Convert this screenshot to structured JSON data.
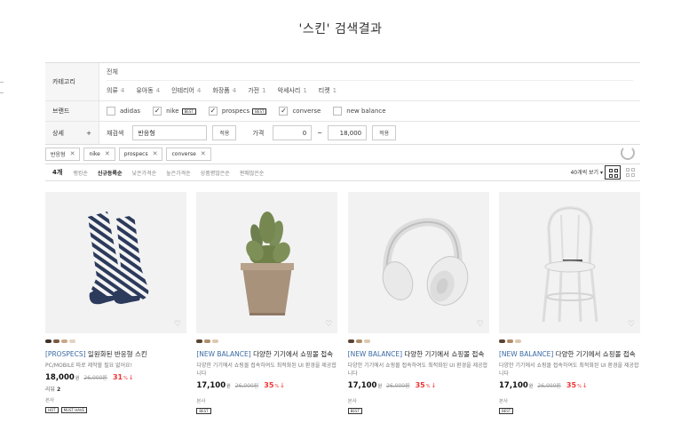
{
  "page": {
    "title": "'스킨' 검색결과"
  },
  "filter": {
    "category": {
      "label": "카테고리",
      "all": "전체",
      "items": [
        {
          "label": "의류",
          "count": "4"
        },
        {
          "label": "유아동",
          "count": "4"
        },
        {
          "label": "인테리어",
          "count": "4"
        },
        {
          "label": "화장품",
          "count": "4"
        },
        {
          "label": "가전",
          "count": "1"
        },
        {
          "label": "악세사리",
          "count": "1"
        },
        {
          "label": "티켓",
          "count": "1"
        }
      ]
    },
    "brand": {
      "label": "브랜드",
      "items": [
        {
          "label": "adidas",
          "checked": "",
          "tag": ""
        },
        {
          "label": "nike",
          "checked": "✓",
          "tag": "BEST"
        },
        {
          "label": "prospecs",
          "checked": "✓",
          "tag": "BEST"
        },
        {
          "label": "converse",
          "checked": "✓",
          "tag": ""
        },
        {
          "label": "new balance",
          "checked": "",
          "tag": ""
        }
      ]
    },
    "detail": {
      "label": "상세",
      "toggle": "+",
      "research_label": "재검색",
      "research_value": "반응형",
      "apply": "적용",
      "price_label": "가격",
      "price_min": "0",
      "price_sep": "~",
      "price_max": "18,000",
      "apply2": "적용"
    }
  },
  "chips": [
    {
      "label": "반응형",
      "x": "✕"
    },
    {
      "label": "nike",
      "x": "✕"
    },
    {
      "label": "prospecs",
      "x": "✕"
    },
    {
      "label": "converse",
      "x": "✕"
    }
  ],
  "sort": {
    "count": "4개",
    "items": [
      "랭킹순",
      "신규등록순",
      "낮은가격순",
      "높은가격순",
      "상품평많은순",
      "판매많은순"
    ],
    "active": "신규등록순",
    "perpage": "40개씩 보기 ▾"
  },
  "products": [
    {
      "brand": "[PROSPECS]",
      "name": " 일원화된 반응형 스킨",
      "desc": "PC/MOBILE 따로 제작할 필요 없어요!",
      "price": "18,000",
      "won": "원",
      "old": "26,000원",
      "disc": "31",
      "pct": "%",
      "arrow": "↓",
      "reviews_label": "리뷰",
      "reviews": "2",
      "ship": "본사",
      "tags": [
        "HOT",
        "MUST HAVE"
      ],
      "swatches": [
        "#3d3329",
        "#7a5a3e",
        "#c9a886",
        "#e2d3c0"
      ],
      "image": "socks"
    },
    {
      "brand": "[NEW BALANCE]",
      "name": " 다양한 기기에서 쇼핑몰 접속",
      "desc": "다양한 기기에서 쇼핑몰 접속하여도 최적화된 UI 환경을 제공합니다",
      "price": "17,100",
      "won": "원",
      "old": "26,000원",
      "disc": "35",
      "pct": "%",
      "arrow": "↓",
      "reviews_label": "",
      "reviews": "",
      "ship": "본사",
      "tags": [
        "BEST"
      ],
      "swatches": [
        "#5b4331",
        "#b08e6c",
        "#ddc9b0"
      ],
      "image": "cactus"
    },
    {
      "brand": "[NEW BALANCE]",
      "name": " 다양한 기기에서 쇼핑몰 접속",
      "desc": "다양한 기기에서 쇼핑몰 접속하여도 최적화된 UI 환경을 제공합니다",
      "price": "17,100",
      "won": "원",
      "old": "26,000원",
      "disc": "35",
      "pct": "%",
      "arrow": "↓",
      "reviews_label": "",
      "reviews": "",
      "ship": "본사",
      "tags": [
        "BEST"
      ],
      "swatches": [
        "#5b4331",
        "#b08e6c",
        "#ddc9b0"
      ],
      "image": "headphones"
    },
    {
      "brand": "[NEW BALANCE]",
      "name": " 다양한 기기에서 쇼핑몰 접속",
      "desc": "다양한 기기에서 쇼핑몰 접속하여도 최적화된 UI 환경을 제공합니다",
      "price": "17,100",
      "won": "원",
      "old": "26,000원",
      "disc": "35",
      "pct": "%",
      "arrow": "↓",
      "reviews_label": "",
      "reviews": "",
      "ship": "본사",
      "tags": [
        "BEST"
      ],
      "swatches": [
        "#5b4331",
        "#b08e6c",
        "#ddc9b0"
      ],
      "image": "chair"
    }
  ],
  "colors": {
    "brand_link": "#3a6aa5",
    "discount": "#e33333"
  }
}
